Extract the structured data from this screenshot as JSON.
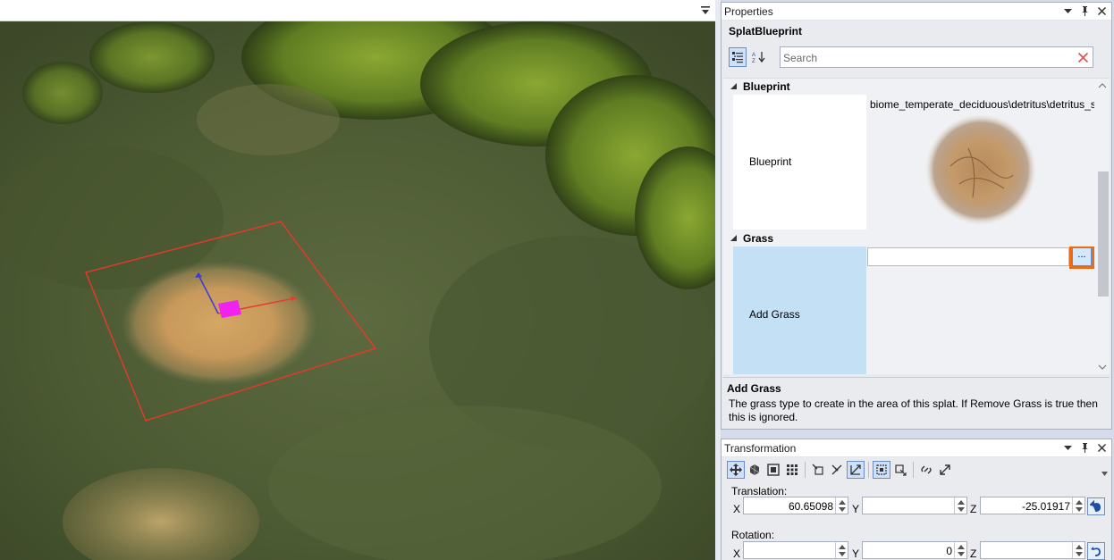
{
  "viewport": {
    "menu_icon": "dropdown-arrow-icon"
  },
  "properties": {
    "title": "Properties",
    "object_type": "SplatBlueprint",
    "search": {
      "placeholder": "Search",
      "value": ""
    },
    "categories": {
      "blueprint": {
        "label": "Blueprint",
        "prop_label": "Blueprint",
        "value": "biome_temperate_deciduous\\detritus\\detritus_s"
      },
      "grass": {
        "label": "Grass",
        "prop_label": "Add Grass",
        "value": "",
        "browse_label": "..."
      }
    },
    "description": {
      "title": "Add Grass",
      "text": "The grass type to create in the area of this splat. If Remove Grass is true then this is ignored."
    }
  },
  "transformation": {
    "title": "Transformation",
    "translation": {
      "label": "Translation:",
      "x_label": "X",
      "y_label": "Y",
      "z_label": "Z",
      "x": "60.65098",
      "y": "",
      "z": "-25.01917"
    },
    "rotation": {
      "label": "Rotation:",
      "x_label": "X",
      "y_label": "Y",
      "z_label": "Z",
      "x": "",
      "y": "0",
      "z": ""
    }
  },
  "colors": {
    "highlight_outline": "#ea6a15",
    "selected_row": "#c3e0f5",
    "gizmo_selection": "#e03a2a",
    "gizmo_x": "#e63b2e",
    "gizmo_y": "#3a3adf",
    "gizmo_center": "#f022f0"
  }
}
